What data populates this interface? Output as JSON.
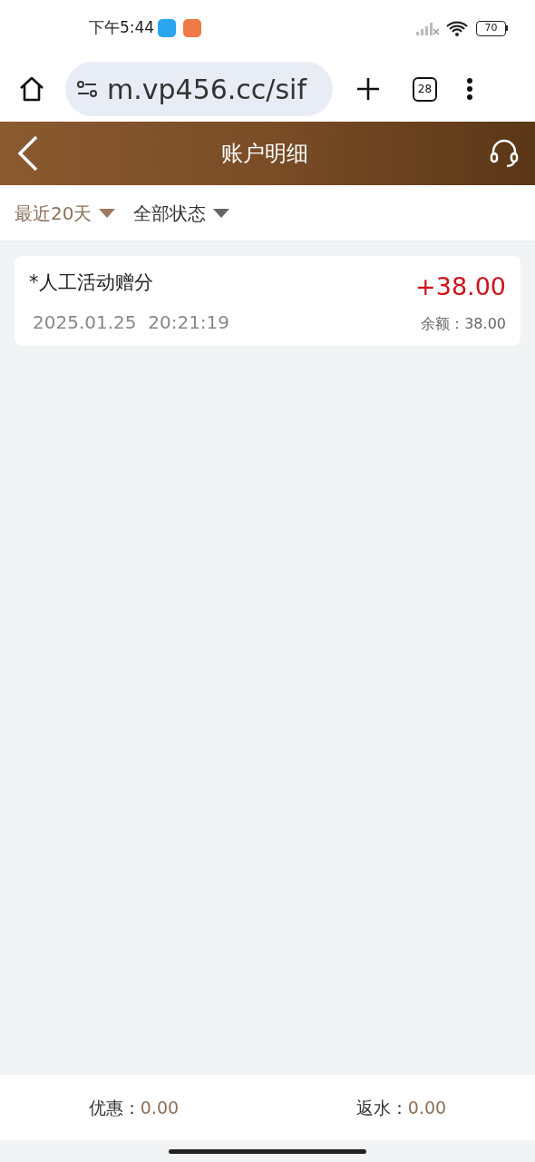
{
  "status_bar": {
    "time": "下午5:44",
    "battery": "70"
  },
  "browser": {
    "url": "m.vp456.cc/sif",
    "tab_count": "28"
  },
  "header": {
    "title": "账户明细"
  },
  "filters": [
    {
      "label": "最近20天",
      "selected": true
    },
    {
      "label": "全部状态",
      "selected": false
    }
  ],
  "transactions": [
    {
      "title": "*人工活动赠分",
      "time": "2025.01.25  20:21:19",
      "amount": "+38.00",
      "balance_label": "余额：",
      "balance": "38.00"
    }
  ],
  "footer": [
    {
      "label": "优惠：",
      "value": "0.00"
    },
    {
      "label": "返水：",
      "value": "0.00"
    }
  ]
}
